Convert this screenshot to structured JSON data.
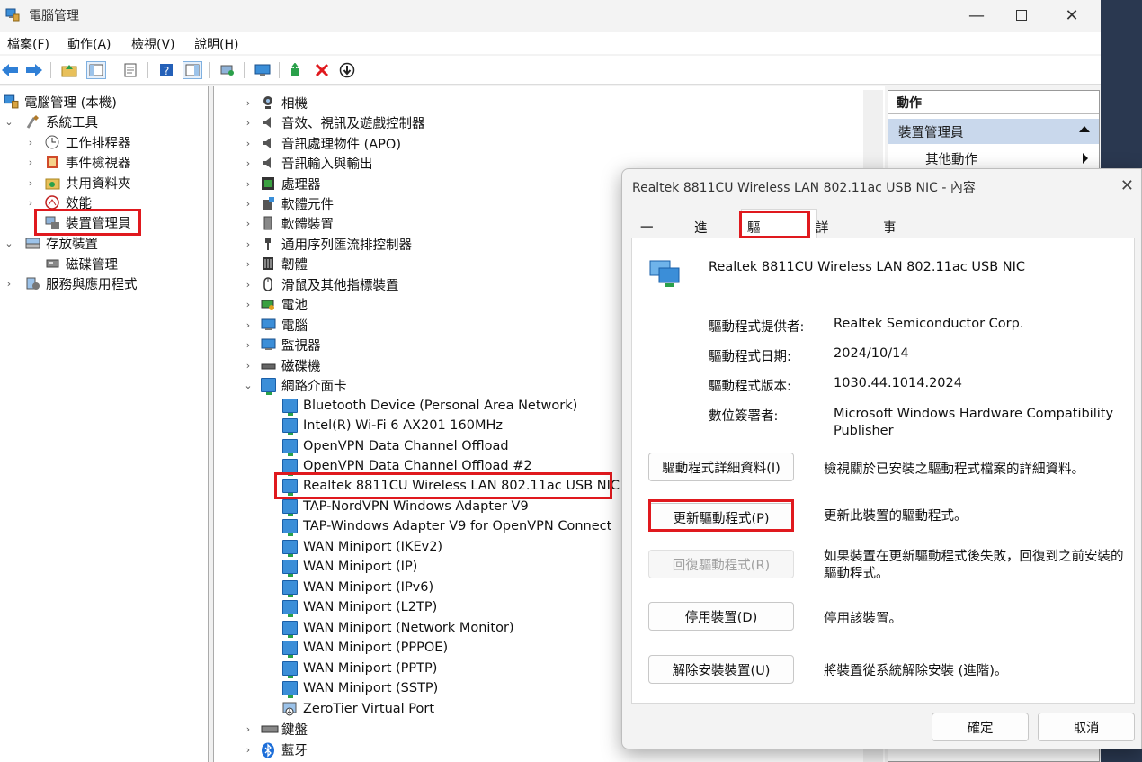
{
  "window": {
    "title": "電腦管理"
  },
  "menu": [
    "檔案(F)",
    "動作(A)",
    "檢視(V)",
    "說明(H)"
  ],
  "left_tree": {
    "root": "電腦管理 (本機)",
    "system_tools": "系統工具",
    "task_scheduler": "工作排程器",
    "event_viewer": "事件檢視器",
    "shared_folders": "共用資料夾",
    "performance": "效能",
    "device_manager": "裝置管理員",
    "storage": "存放裝置",
    "disk_management": "磁碟管理",
    "services": "服務與應用程式"
  },
  "device_categories": {
    "camera": "相機",
    "sound": "音效、視訊及遊戲控制器",
    "apo": "音訊處理物件 (APO)",
    "audio_io": "音訊輸入與輸出",
    "processor": "處理器",
    "software_components": "軟體元件",
    "software_devices": "軟體裝置",
    "usb": "通用序列匯流排控制器",
    "firmware": "韌體",
    "mice": "滑鼠及其他指標裝置",
    "battery": "電池",
    "computer": "電腦",
    "monitors": "監視器",
    "disk_drives": "磁碟機",
    "network": "網路介面卡",
    "keyboard": "鍵盤",
    "bluetooth": "藍牙"
  },
  "network_adapters": [
    "Bluetooth Device (Personal Area Network)",
    "Intel(R) Wi-Fi 6 AX201 160MHz",
    "OpenVPN Data Channel Offload",
    "OpenVPN Data Channel Offload #2",
    "Realtek 8811CU Wireless LAN 802.11ac USB NIC",
    "TAP-NordVPN Windows Adapter V9",
    "TAP-Windows Adapter V9 for OpenVPN Connect",
    "WAN Miniport (IKEv2)",
    "WAN Miniport (IP)",
    "WAN Miniport (IPv6)",
    "WAN Miniport (L2TP)",
    "WAN Miniport (Network Monitor)",
    "WAN Miniport (PPPOE)",
    "WAN Miniport (PPTP)",
    "WAN Miniport (SSTP)",
    "ZeroTier Virtual Port"
  ],
  "actions": {
    "header": "動作",
    "device_manager": "裝置管理員",
    "more_actions": "其他動作"
  },
  "dialog": {
    "title": "Realtek 8811CU Wireless LAN 802.11ac USB NIC - 內容",
    "tabs": [
      "一般",
      "進階",
      "驅動程式",
      "詳細資料",
      "事件"
    ],
    "active_tab": "驅動程式",
    "device_name": "Realtek 8811CU Wireless LAN 802.11ac USB NIC",
    "provider_label": "驅動程式提供者:",
    "provider_value": "Realtek Semiconductor Corp.",
    "date_label": "驅動程式日期:",
    "date_value": "2024/10/14",
    "version_label": "驅動程式版本:",
    "version_value": "1030.44.1014.2024",
    "signer_label": "數位簽署者:",
    "signer_value": "Microsoft Windows Hardware Compatibility Publisher",
    "buttons": {
      "details": "驅動程式詳細資料(I)",
      "update": "更新驅動程式(P)",
      "rollback": "回復驅動程式(R)",
      "disable": "停用裝置(D)",
      "uninstall": "解除安裝裝置(U)"
    },
    "descriptions": {
      "details": "檢視關於已安裝之驅動程式檔案的詳細資料。",
      "update": "更新此裝置的驅動程式。",
      "rollback": "如果裝置在更新驅動程式後失敗，回復到之前安裝的驅動程式。",
      "disable": "停用該裝置。",
      "uninstall": "將裝置從系統解除安裝 (進階)。"
    },
    "ok": "確定",
    "cancel": "取消"
  },
  "colors": {
    "highlight": "#e0191e",
    "actions_header": "#c9d8ec",
    "network_icon": "#3b8ed8"
  }
}
